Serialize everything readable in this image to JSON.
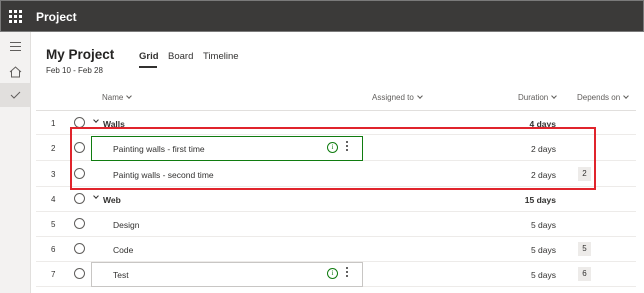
{
  "topbar": {
    "app_title": "Project"
  },
  "project": {
    "title": "My Project",
    "dates": "Feb 10 - Feb 28"
  },
  "tabs": [
    {
      "label": "Grid",
      "active": true
    },
    {
      "label": "Board",
      "active": false
    },
    {
      "label": "Timeline",
      "active": false
    }
  ],
  "columns": {
    "name": "Name",
    "assigned_to": "Assigned to",
    "duration": "Duration",
    "depends_on": "Depends on"
  },
  "rows": [
    {
      "num": "1",
      "name": "Walls",
      "type": "group",
      "duration": "4 days",
      "depends": ""
    },
    {
      "num": "2",
      "name": "Painting walls - first time",
      "type": "task",
      "duration": "2 days",
      "depends": ""
    },
    {
      "num": "3",
      "name": "Paintig walls - second time",
      "type": "task",
      "duration": "2 days",
      "depends": "2"
    },
    {
      "num": "4",
      "name": "Web",
      "type": "group",
      "duration": "15 days",
      "depends": ""
    },
    {
      "num": "5",
      "name": "Design",
      "type": "task",
      "duration": "5 days",
      "depends": ""
    },
    {
      "num": "6",
      "name": "Code",
      "type": "task",
      "duration": "5 days",
      "depends": "5"
    },
    {
      "num": "7",
      "name": "Test",
      "type": "task",
      "duration": "5 days",
      "depends": "6"
    }
  ],
  "icons": {
    "waffle": "app-launcher-icon",
    "menu": "hamburger-icon",
    "home": "home-icon",
    "check": "checkmark-icon",
    "info": "info-icon",
    "more": "more-vertical-icon"
  },
  "colors": {
    "topbar": "#3b3a39",
    "accent_green": "#107c10",
    "annotation_red": "#e0242c"
  }
}
